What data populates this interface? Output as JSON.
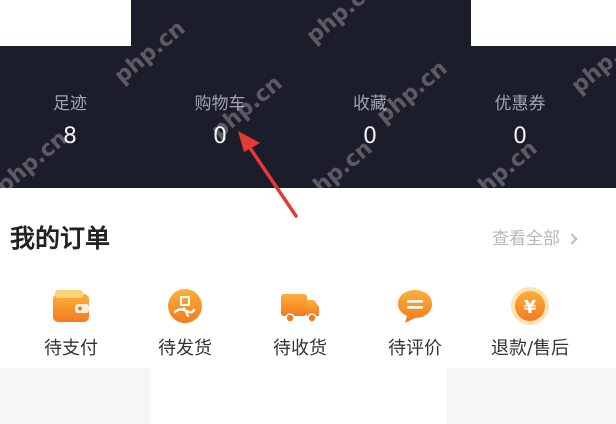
{
  "stats": [
    {
      "label": "足迹",
      "value": "8"
    },
    {
      "label": "购物车",
      "value": "0"
    },
    {
      "label": "收藏",
      "value": "0"
    },
    {
      "label": "优惠券",
      "value": "0"
    }
  ],
  "orders": {
    "title": "我的订单",
    "view_all": "查看全部",
    "items": [
      {
        "label": "待支付",
        "icon": "wallet-icon"
      },
      {
        "label": "待发货",
        "icon": "package-hand-icon"
      },
      {
        "label": "待收货",
        "icon": "truck-icon"
      },
      {
        "label": "待评价",
        "icon": "comment-icon"
      },
      {
        "label": "退款/售后",
        "icon": "yen-coin-icon"
      }
    ]
  },
  "watermark": "php.cn",
  "colors": {
    "header_bg": "#1c1d2a",
    "icon_orange": "#f7a21c",
    "arrow_red": "#e53935"
  }
}
